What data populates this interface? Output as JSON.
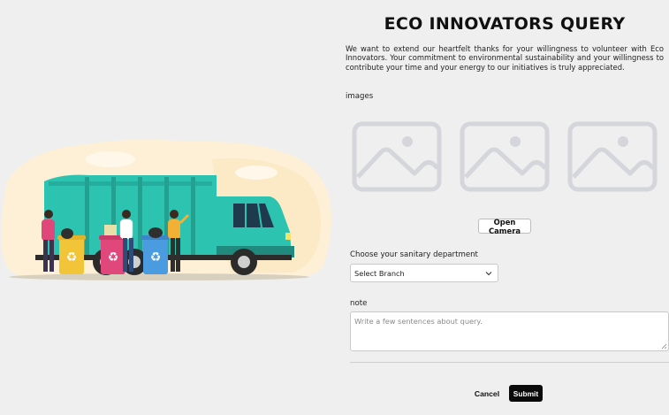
{
  "header": {
    "title": "ECO INNOVATORS QUERY",
    "intro": "We want to extend our heartfelt thanks for your willingness to volunteer with Eco Innovators. Your commitment to environmental sustainability and your willingness to contribute your time and your energy to our initiatives is truly appreciated."
  },
  "images": {
    "label": "images",
    "placeholders": [
      "image-placeholder-icon",
      "image-placeholder-icon",
      "image-placeholder-icon"
    ],
    "open_camera_label": "Open Camera"
  },
  "department": {
    "label": "Choose your sanitary department",
    "selected": "Select Branch"
  },
  "note": {
    "label": "note",
    "placeholder": "Write a few sentences about query."
  },
  "actions": {
    "cancel_label": "Cancel",
    "submit_label": "Submit"
  },
  "illustration": {
    "icon": "garbage-truck-volunteers-illustration",
    "colors": {
      "truck": "#2cc3b0",
      "bin_yellow": "#f2c437",
      "bin_pink": "#e0477a",
      "bin_blue": "#4a9be0",
      "backdrop": "#fdf0d6"
    }
  },
  "colors": {
    "background": "#efefef",
    "submit_bg": "#0a0a0a",
    "placeholder_icon": "#d4d6db"
  }
}
